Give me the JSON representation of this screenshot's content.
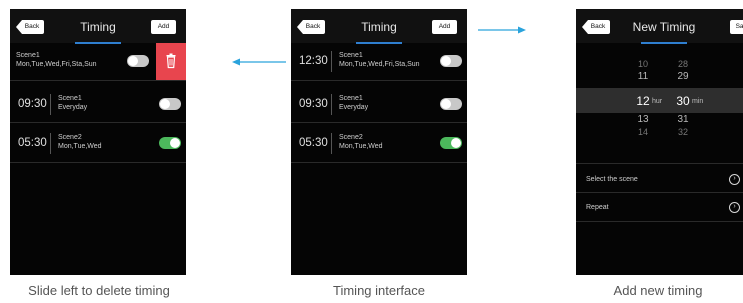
{
  "colors": {
    "accent": "#2f7fd0",
    "toggle_on": "#4cb85c",
    "toggle_off": "#c8c8c8",
    "delete": "#e8454e",
    "connector": "#2aa3dc"
  },
  "screen_delete": {
    "back": "Back",
    "title": "Timing",
    "add": "Add",
    "rows": [
      {
        "time": "",
        "name": "Scene1",
        "days": "Mon,Tue,Wed,Fri,Sta,Sun",
        "enabled": false
      },
      {
        "time": "09:30",
        "name": "Scene1",
        "days": "Everyday",
        "enabled": false
      },
      {
        "time": "05:30",
        "name": "Scene2",
        "days": "Mon,Tue,Wed",
        "enabled": true
      }
    ],
    "delete_icon": "trash-icon"
  },
  "screen_timing": {
    "back": "Back",
    "title": "Timing",
    "add": "Add",
    "rows": [
      {
        "time": "12:30",
        "name": "Scene1",
        "days": "Mon,Tue,Wed,Fri,Sta,Sun",
        "enabled": false
      },
      {
        "time": "09:30",
        "name": "Scene1",
        "days": "Everyday",
        "enabled": false
      },
      {
        "time": "05:30",
        "name": "Scene2",
        "days": "Mon,Tue,Wed",
        "enabled": true
      }
    ]
  },
  "screen_new": {
    "back": "Back",
    "title": "New Timing",
    "save": "Save",
    "picker": {
      "hours": [
        "10",
        "11",
        "12",
        "13",
        "14"
      ],
      "minutes": [
        "28",
        "29",
        "30",
        "31",
        "32"
      ],
      "hour_unit": "hur",
      "minute_unit": "min"
    },
    "select_scene": "Select the scene",
    "repeat": "Repeat",
    "chevron_icon": "chevron-right-circle-icon"
  },
  "captions": {
    "left": "Slide left to delete timing",
    "middle": "Timing interface",
    "right": "Add new timing"
  }
}
